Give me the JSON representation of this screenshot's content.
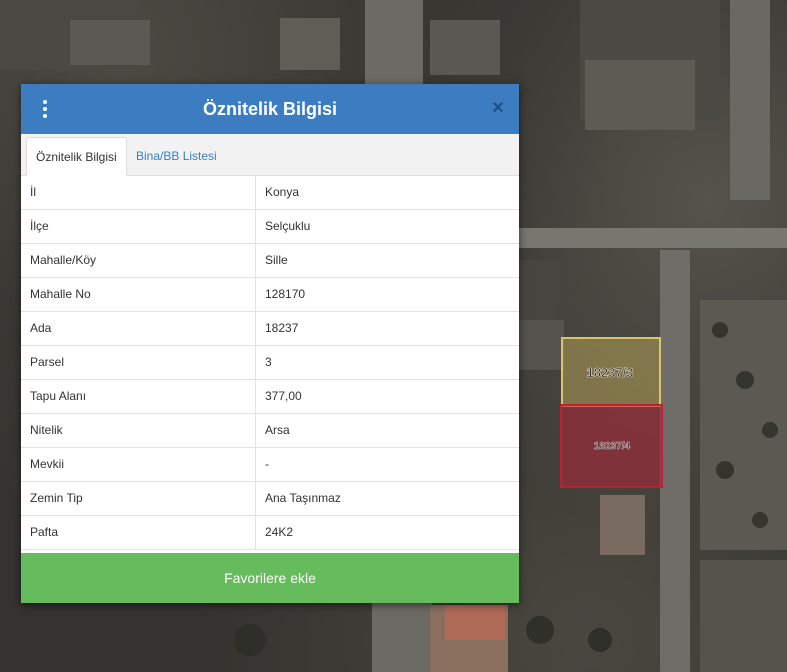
{
  "map": {
    "parcel_labels": [
      "18237/3",
      "18237/4"
    ]
  },
  "dialog": {
    "title": "Öznitelik Bilgisi",
    "menu_icon": "kebab-vertical-icon",
    "close_icon": "close-icon",
    "close_glyph": "×",
    "tabs": [
      {
        "label": "Öznitelik Bilgisi",
        "active": true
      },
      {
        "label": "Bina/BB Listesi",
        "active": false
      }
    ],
    "rows": [
      {
        "key": "İl",
        "value": "Konya"
      },
      {
        "key": "İlçe",
        "value": "Selçuklu"
      },
      {
        "key": "Mahalle/Köy",
        "value": "Sille"
      },
      {
        "key": "Mahalle No",
        "value": "128170"
      },
      {
        "key": "Ada",
        "value": "18237"
      },
      {
        "key": "Parsel",
        "value": "3"
      },
      {
        "key": "Tapu Alanı",
        "value": "377,00"
      },
      {
        "key": "Nitelik",
        "value": "Arsa"
      },
      {
        "key": "Mevkii",
        "value": "-"
      },
      {
        "key": "Zemin Tip",
        "value": "Ana Taşınmaz"
      },
      {
        "key": "Pafta",
        "value": "24K2"
      }
    ],
    "favorite_button": "Favorilere ekle"
  },
  "colors": {
    "header": "#3c7dc2",
    "button": "#66bb5c",
    "parcel_selected": "#c9b15a",
    "parcel_neighbor": "#b3263a"
  }
}
